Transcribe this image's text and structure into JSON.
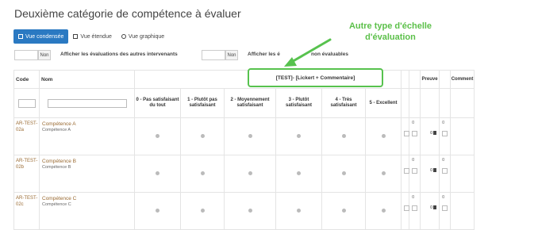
{
  "page": {
    "title": "Deuxième catégorie de compétence à évaluer"
  },
  "tabs": [
    {
      "label": "Vue condensée",
      "icon": "condensed-view-icon"
    },
    {
      "label": "Vue étendue",
      "icon": "extended-view-icon"
    },
    {
      "label": "Vue graphique",
      "icon": "chart-view-icon"
    }
  ],
  "filters": {
    "btn1": "Non",
    "text1": "Afficher les évaluations des autres intervenants",
    "btn2": "Non",
    "text2": "Afficher les é",
    "text3": "non évaluables"
  },
  "table": {
    "col_code": "Code",
    "col_name": "Nom",
    "scale_header": "[TEST]- [Lickert + Commentaire]",
    "levels": [
      "0 - Pas satisfaisant du tout",
      "1 - Plutôt pas satisfaisant",
      "2 - Moyennement satisfaisant",
      "3 - Plutôt satisfaisant",
      "4 - Très satisfaisant",
      "5 - Excellent"
    ],
    "col_preuve": "Preuve",
    "col_comment": "Comment",
    "rows": [
      {
        "code": "AR-TEST-02a",
        "name": "Compétence A",
        "sub": "Compétence A",
        "z1": "0",
        "z2": "0",
        "proof_count": "0"
      },
      {
        "code": "AR-TEST-02b",
        "name": "Compétence B",
        "sub": "Compétence B",
        "z1": "0",
        "z2": "0",
        "proof_count": "0"
      },
      {
        "code": "AR-TEST-02c",
        "name": "Compétence C",
        "sub": "Compétence C",
        "z1": "0",
        "z2": "0",
        "proof_count": "0"
      }
    ]
  },
  "annotation": {
    "line1": "Autre type d'échelle",
    "line2": "d'évaluation",
    "color": "#5cc04a"
  }
}
